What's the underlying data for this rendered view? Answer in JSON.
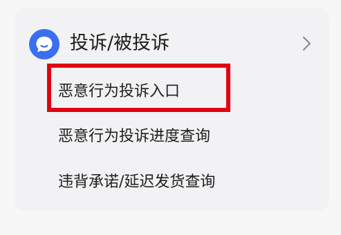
{
  "section": {
    "title": "投诉/被投诉",
    "icon": "chat-bubble-icon",
    "expand_icon": "chevron-right-icon",
    "accent_color": "#3a70f0"
  },
  "menu": {
    "items": [
      {
        "label": "恶意行为投诉入口",
        "highlighted": true
      },
      {
        "label": "恶意行为投诉进度查询",
        "highlighted": false
      },
      {
        "label": "违背承诺/延迟发货查询",
        "highlighted": false
      }
    ]
  },
  "annotation": {
    "highlight_color": "#e3000f"
  }
}
